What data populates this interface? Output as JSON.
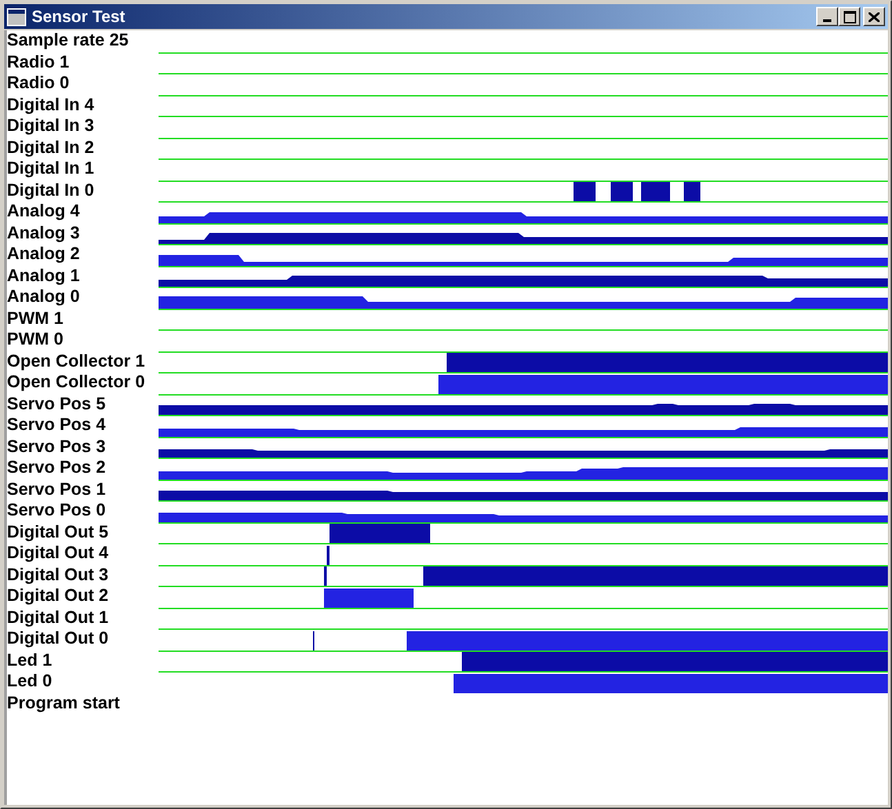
{
  "window": {
    "title": "Sensor Test"
  },
  "rows": [
    {
      "label": "Sample rate 25",
      "kind": "text"
    },
    {
      "label": "Radio 1",
      "kind": "trace"
    },
    {
      "label": "Radio 0",
      "kind": "trace"
    },
    {
      "label": "Digital In 4",
      "kind": "trace"
    },
    {
      "label": "Digital In 3",
      "kind": "trace"
    },
    {
      "label": "Digital In 2",
      "kind": "trace"
    },
    {
      "label": "Digital In 1",
      "kind": "trace"
    },
    {
      "label": "Digital In 0",
      "kind": "trace"
    },
    {
      "label": "Analog 4",
      "kind": "trace"
    },
    {
      "label": "Analog 3",
      "kind": "trace"
    },
    {
      "label": "Analog 2",
      "kind": "trace"
    },
    {
      "label": "Analog 1",
      "kind": "trace"
    },
    {
      "label": "Analog 0",
      "kind": "trace"
    },
    {
      "label": "PWM 1",
      "kind": "trace"
    },
    {
      "label": "PWM 0",
      "kind": "trace"
    },
    {
      "label": "Open Collector 1",
      "kind": "trace"
    },
    {
      "label": "Open Collector 0",
      "kind": "trace"
    },
    {
      "label": "Servo Pos 5",
      "kind": "trace"
    },
    {
      "label": "Servo Pos 4",
      "kind": "trace"
    },
    {
      "label": "Servo Pos 3",
      "kind": "trace"
    },
    {
      "label": "Servo Pos 2",
      "kind": "trace"
    },
    {
      "label": "Servo Pos 1",
      "kind": "trace"
    },
    {
      "label": "Servo Pos 0",
      "kind": "trace"
    },
    {
      "label": "Digital Out 5",
      "kind": "trace"
    },
    {
      "label": "Digital Out 4",
      "kind": "trace"
    },
    {
      "label": "Digital Out 3",
      "kind": "trace"
    },
    {
      "label": "Digital Out 2",
      "kind": "trace"
    },
    {
      "label": "Digital Out 1",
      "kind": "trace"
    },
    {
      "label": "Digital Out 0",
      "kind": "trace"
    },
    {
      "label": "Led 1",
      "kind": "trace"
    },
    {
      "label": "Led 0",
      "kind": "trace"
    },
    {
      "label": "Program start",
      "kind": "text"
    }
  ]
}
